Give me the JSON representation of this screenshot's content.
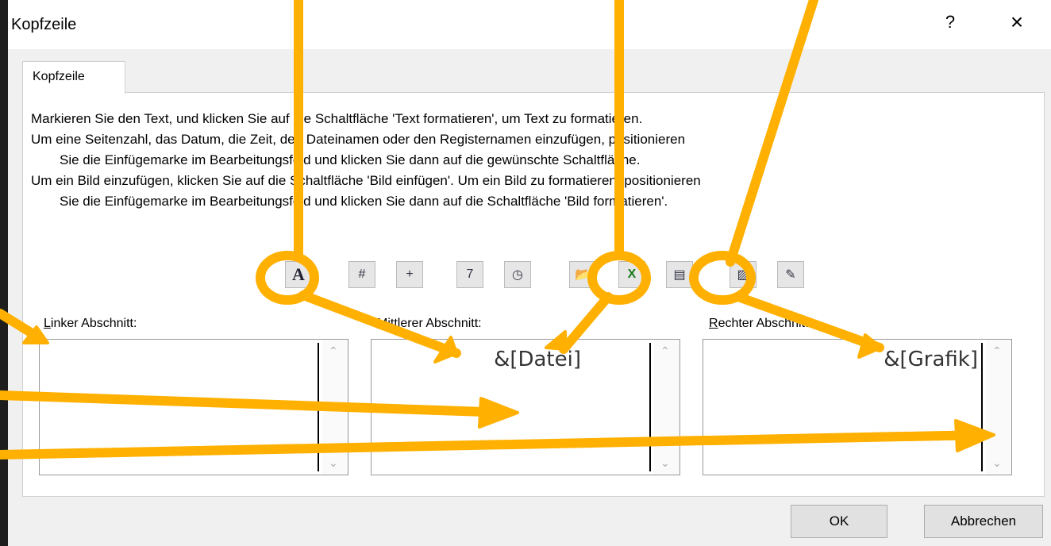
{
  "window": {
    "title": "Kopfzeile",
    "help_label": "?",
    "close_label": "×"
  },
  "tab": {
    "label": "Kopfzeile"
  },
  "instructions": [
    "Markieren Sie den Text, und klicken Sie auf die Schaltfläche 'Text formatieren', um Text zu formatieren.",
    "Um eine Seitenzahl, das Datum, die Zeit, den Dateinamen oder den Registernamen einzufügen, positionieren",
    "Sie die Einfügemarke im Bearbeitungsfeld und klicken Sie dann auf die gewünschte Schaltfläche.",
    "Um ein Bild einzufügen, klicken Sie auf die Schaltfläche 'Bild einfügen'. Um ein Bild zu formatieren, positionieren",
    "Sie die Einfügemarke im Bearbeitungsfeld und klicken Sie dann auf die Schaltfläche 'Bild formatieren'."
  ],
  "toolbar": {
    "format_text": "A",
    "page_number": "#",
    "page_count": "+",
    "date": "7",
    "time": "◷",
    "file_path": "📂",
    "file_name": "X",
    "sheet_name": "▤",
    "picture": "▨",
    "format_picture": "✎"
  },
  "sections": {
    "left": {
      "label_first": "L",
      "label_rest": "inker Abschnitt:",
      "content": ""
    },
    "center": {
      "label_first": "M",
      "label_rest": "ittlerer Abschnitt:",
      "content": "&[Datei]"
    },
    "right": {
      "label_first": "R",
      "label_rest": "echter Abschnitt:",
      "content": "&[Grafik]"
    }
  },
  "buttons": {
    "ok": "OK",
    "cancel": "Abbrechen"
  },
  "colors": {
    "annotation": "#FFB000"
  }
}
